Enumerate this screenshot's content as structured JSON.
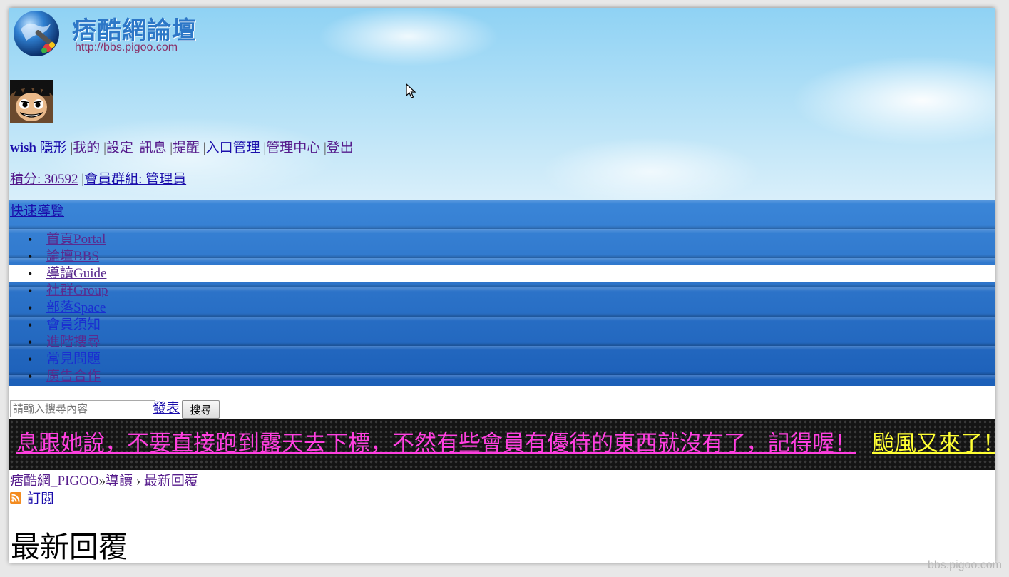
{
  "logo": {
    "title": "痞酷網論壇",
    "url": "http://bbs.pigoo.com"
  },
  "user": {
    "username": "wish",
    "links": [
      "隱形",
      "我的",
      "設定",
      "訊息",
      "提醒",
      "入口管理",
      "管理中心",
      "登出"
    ],
    "separator": "|",
    "credits": "積分: 30592",
    "group": "會員群組: 管理員"
  },
  "nav": {
    "quick": "快速導覽",
    "items": [
      {
        "label": "首頁Portal",
        "active": false
      },
      {
        "label": "論壇BBS",
        "active": false
      },
      {
        "label": "導讀Guide",
        "active": true
      },
      {
        "label": "社群Group",
        "active": false
      },
      {
        "label": "部落Space",
        "active": false
      },
      {
        "label": "會員須知",
        "active": false
      },
      {
        "label": "進階搜尋",
        "active": false
      },
      {
        "label": "常見問題",
        "active": false
      },
      {
        "label": "廣告合作",
        "active": false
      }
    ]
  },
  "search": {
    "placeholder": "請輸入搜尋內容",
    "post_label": "發表",
    "button_label": "搜尋"
  },
  "marquee": {
    "message1": "息跟她說，不要直接跑到露天去下標，不然有些會員有優待的東西就沒有了，記得喔！",
    "message2": "颱風又來了！請",
    "colors": {
      "message1": "#ff3fe0",
      "message2": "#ffff33"
    }
  },
  "breadcrumb": {
    "home": "痞酷網_PIGOO",
    "sep1": "»",
    "section": "導讀",
    "sep2": "›",
    "current": "最新回覆"
  },
  "rss": {
    "label": "訂閱",
    "icon": "rss-icon"
  },
  "page_title": "最新回覆",
  "watermark": "bbs.pigoo.com",
  "colors": {
    "nav_band": "#2a6fc8",
    "sky": "#8fd2f4"
  }
}
